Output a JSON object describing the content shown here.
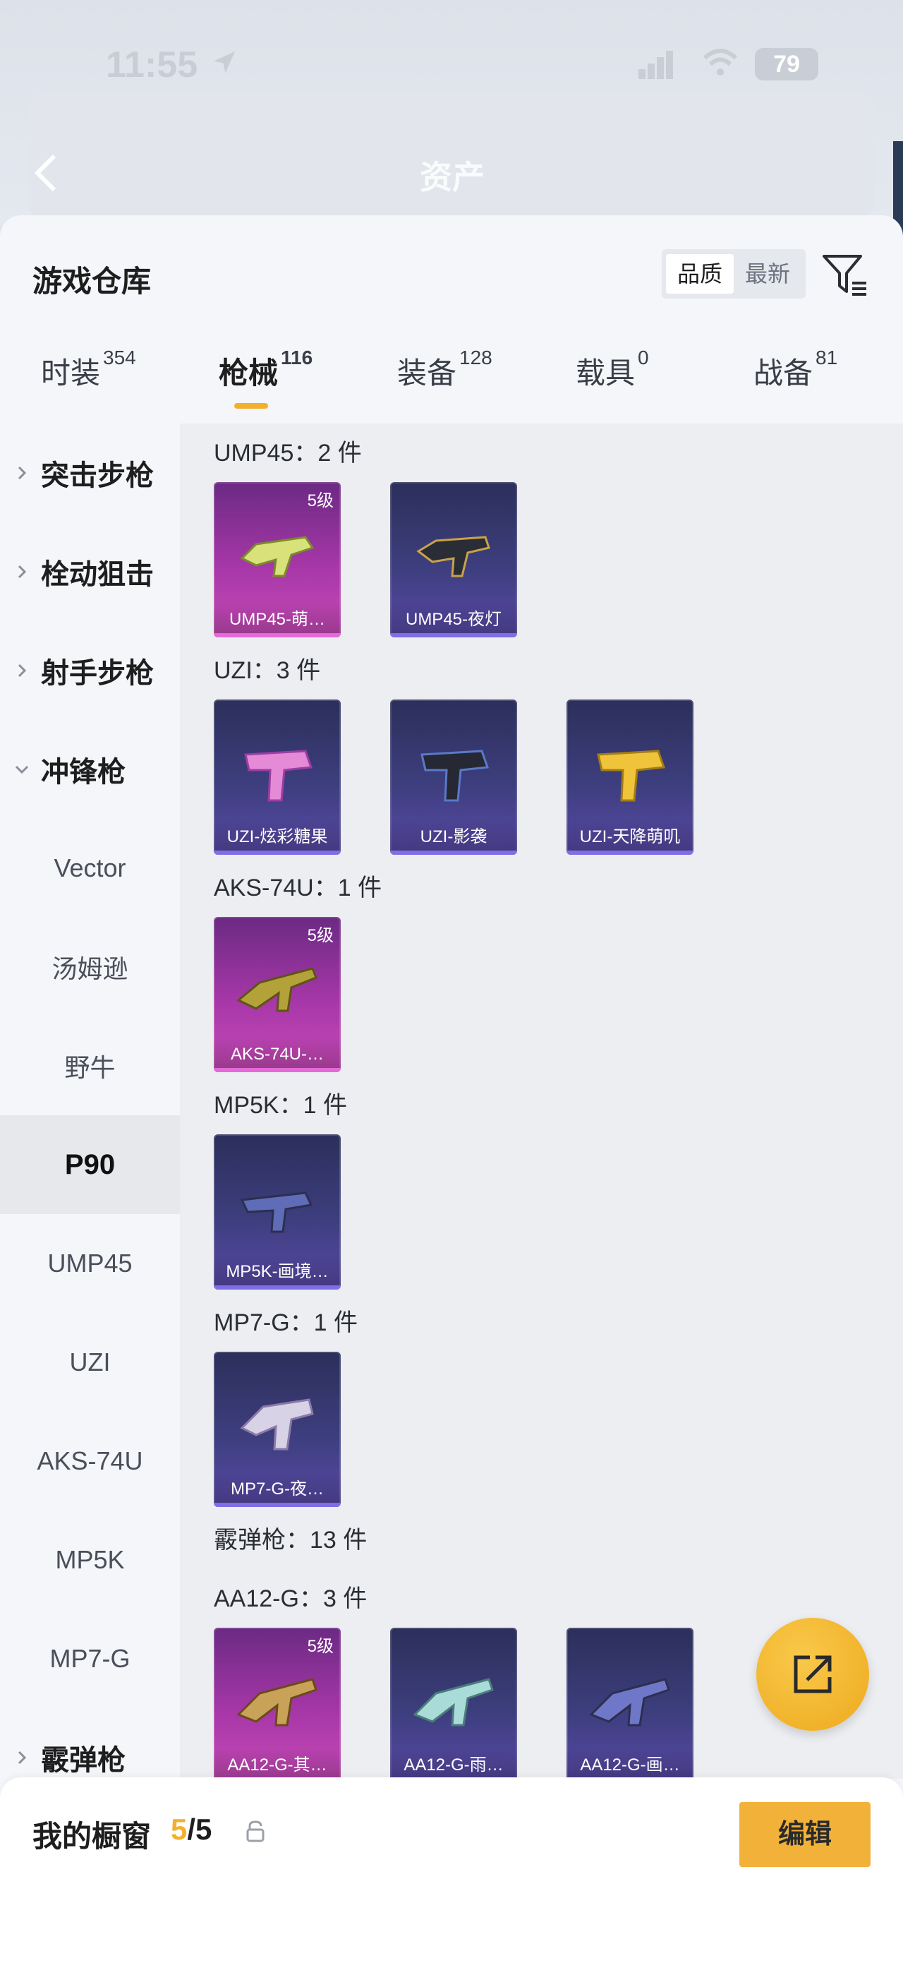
{
  "status_bar": {
    "time": "11:55",
    "battery": "79"
  },
  "background_header": {
    "title": "资产"
  },
  "sheet": {
    "title": "游戏仓库",
    "sort": {
      "options": [
        "品质",
        "最新"
      ],
      "active": "品质"
    }
  },
  "tabs": [
    {
      "label": "时装",
      "count": "354"
    },
    {
      "label": "枪械",
      "count": "116"
    },
    {
      "label": "装备",
      "count": "128"
    },
    {
      "label": "载具",
      "count": "0"
    },
    {
      "label": "战备",
      "count": "81"
    }
  ],
  "sidebar": {
    "items": [
      {
        "label": "突击步枪"
      },
      {
        "label": "栓动狙击"
      },
      {
        "label": "射手步枪"
      },
      {
        "label": "冲锋枪"
      },
      {
        "label": "Vector"
      },
      {
        "label": "汤姆逊"
      },
      {
        "label": "野牛"
      },
      {
        "label": "P90"
      },
      {
        "label": "UMP45"
      },
      {
        "label": "UZI"
      },
      {
        "label": "AKS-74U"
      },
      {
        "label": "MP5K"
      },
      {
        "label": "MP7-G"
      },
      {
        "label": "霰弹枪"
      }
    ]
  },
  "groups": [
    {
      "title": "UMP45：2 件",
      "items": [
        {
          "name": "UMP45-萌…",
          "level": "5级",
          "rarity": "purple"
        },
        {
          "name": "UMP45-夜灯",
          "level": "",
          "rarity": "blue"
        }
      ]
    },
    {
      "title": "UZI：3 件",
      "items": [
        {
          "name": "UZI-炫彩糖果",
          "level": "",
          "rarity": "blue"
        },
        {
          "name": "UZI-影袭",
          "level": "",
          "rarity": "blue"
        },
        {
          "name": "UZI-天降萌叽",
          "level": "",
          "rarity": "blue"
        }
      ]
    },
    {
      "title": "AKS-74U：1 件",
      "items": [
        {
          "name": "AKS-74U-…",
          "level": "5级",
          "rarity": "purple"
        }
      ]
    },
    {
      "title": "MP5K：1 件",
      "items": [
        {
          "name": "MP5K-画境…",
          "level": "",
          "rarity": "blue"
        }
      ]
    },
    {
      "title": "MP7-G：1 件",
      "items": [
        {
          "name": "MP7-G-夜…",
          "level": "",
          "rarity": "blue"
        }
      ]
    },
    {
      "title": "霰弹枪：13 件",
      "items": []
    },
    {
      "title": "AA12-G：3 件",
      "items": [
        {
          "name": "AA12-G-其…",
          "level": "5级",
          "rarity": "purple"
        },
        {
          "name": "AA12-G-雨…",
          "level": "",
          "rarity": "blue"
        },
        {
          "name": "AA12-G-画…",
          "level": "",
          "rarity": "blue"
        }
      ]
    }
  ],
  "bottom_bar": {
    "label": "我的橱窗",
    "count_current": "5",
    "count_sep": "/",
    "count_total": "5",
    "edit_label": "编辑"
  },
  "colors": {
    "accent": "#f2b02d",
    "rarity_purple": "#c84bb7",
    "rarity_blue": "#5a4aa8"
  },
  "icons": [
    "back-icon",
    "location-arrow-icon",
    "signal-icon",
    "wifi-icon",
    "filter-icon",
    "share-icon",
    "lock-icon",
    "chevron-right-icon",
    "chevron-down-icon"
  ]
}
